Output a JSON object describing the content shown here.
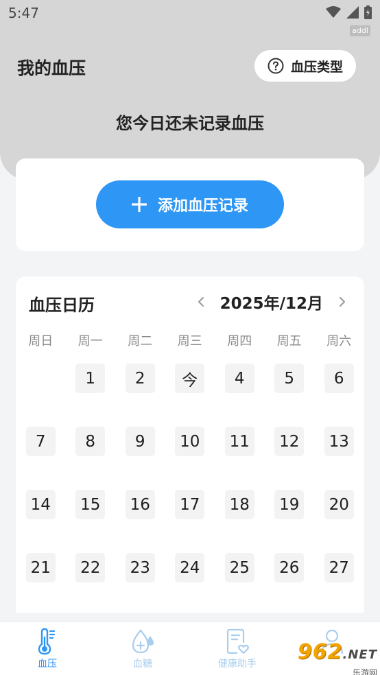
{
  "status_bar": {
    "time": "5:47",
    "tag": "addl"
  },
  "header": {
    "title": "我的血压",
    "type_button_label": "血压类型",
    "no_record_text": "您今日还未记录血压"
  },
  "add_record": {
    "label": "添加血压记录"
  },
  "calendar": {
    "title": "血压日历",
    "month_label": "2025年/12月",
    "weekdays": [
      "周日",
      "周一",
      "周二",
      "周三",
      "周四",
      "周五",
      "周六"
    ],
    "days": [
      "1",
      "2",
      "今",
      "4",
      "5",
      "6",
      "7",
      "8",
      "9",
      "10",
      "11",
      "12",
      "13",
      "14",
      "15",
      "16",
      "17",
      "18",
      "19",
      "20",
      "21",
      "22",
      "23",
      "24",
      "25",
      "26",
      "27"
    ],
    "first_weekday_index": 1
  },
  "tabs": [
    {
      "label": "血压",
      "icon": "thermometer-icon",
      "active": true
    },
    {
      "label": "血糖",
      "icon": "blood-drop-icon",
      "active": false
    },
    {
      "label": "健康助手",
      "icon": "health-assistant-icon",
      "active": false
    },
    {
      "label": "",
      "icon": "profile-icon",
      "active": false
    }
  ],
  "watermark": {
    "main": "962",
    "suffix": ".NET",
    "sub": "乐游网"
  },
  "colors": {
    "accent": "#2e96f5",
    "header_bg": "#d6d6d6",
    "page_bg": "#f3f4f6",
    "day_cell": "#f3f3f3"
  }
}
